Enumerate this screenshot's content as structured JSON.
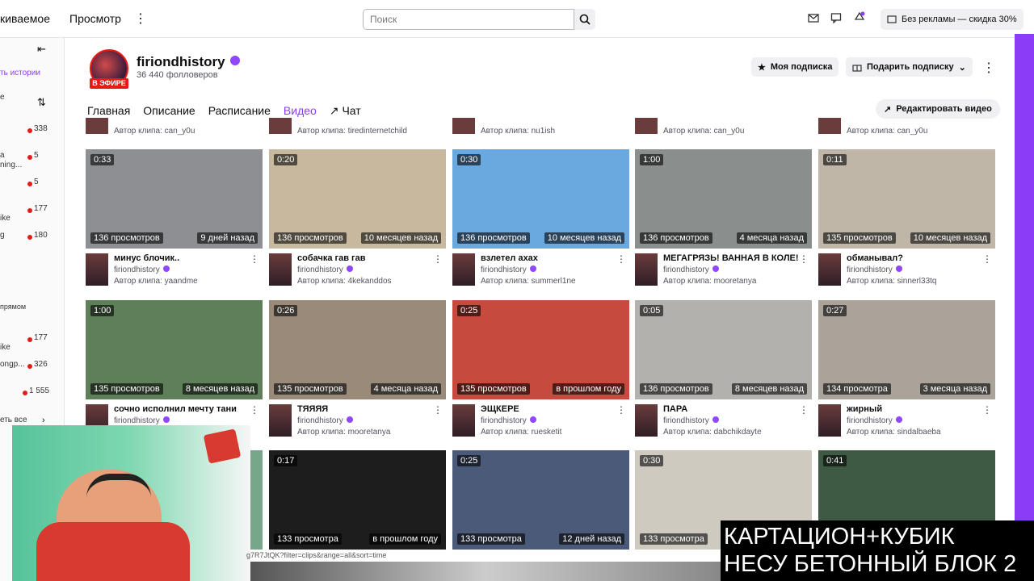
{
  "topbar": {
    "tab_following": "киваемое",
    "tab_browse": "Просмотр",
    "search_placeholder": "Поиск",
    "promo": "Без рекламы — скидка 30%"
  },
  "sidebar": {
    "collapse_label": "",
    "story_label": "ть истории",
    "items": [
      {
        "label": "е",
        "count": ""
      },
      {
        "label": "",
        "count": "338"
      },
      {
        "label": "а",
        "count": "5"
      },
      {
        "label": "ning...",
        "count": ""
      },
      {
        "label": "",
        "count": "5"
      },
      {
        "label": "",
        "count": "177"
      },
      {
        "label": "ike",
        "count": ""
      },
      {
        "label": "g",
        "count": "180"
      },
      {
        "label": "прямом",
        "count": ""
      },
      {
        "label": "",
        "count": "177"
      },
      {
        "label": "ike",
        "count": ""
      },
      {
        "label": "ongp...",
        "count": "326"
      },
      {
        "label": "",
        "count": "1 555"
      },
      {
        "label": "еть все",
        "count": ""
      }
    ]
  },
  "channel": {
    "name": "firiondhistory",
    "followers": "36 440 фолловеров",
    "live_badge": "В ЭФИРЕ",
    "subscribe_btn": "Моя подписка",
    "gift_btn": "Подарить подписку",
    "edit_btn": "Редактировать видео"
  },
  "tabs": [
    "Главная",
    "Описание",
    "Расписание",
    "Видео",
    "Чат"
  ],
  "prev_row": [
    {
      "author": "Автор клипа: can_y0u"
    },
    {
      "author": "Автор клипа: tiredinternetchild"
    },
    {
      "author": "Автор клипа: nu1ish"
    },
    {
      "author": "Автор клипа: can_y0u"
    },
    {
      "author": "Автор клипа: can_y0u"
    }
  ],
  "clips_row1": [
    {
      "dur": "0:33",
      "views": "136 просмотров",
      "ago": "9 дней назад",
      "title": "минус блочик..",
      "channel": "firiondhistory",
      "author": "Автор клипа: yaandme",
      "color": "#8d8f92"
    },
    {
      "dur": "0:20",
      "views": "136 просмотров",
      "ago": "10 месяцев назад",
      "title": "собачка гав гав",
      "channel": "firiondhistory",
      "author": "Автор клипа: 4kekanddos",
      "color": "#c7b89e"
    },
    {
      "dur": "0:30",
      "views": "136 просмотров",
      "ago": "10 месяцев назад",
      "title": "взлетел ахах",
      "channel": "firiondhistory",
      "author": "Автор клипа: summerl1ne",
      "color": "#6aa9e0"
    },
    {
      "dur": "1:00",
      "views": "136 просмотров",
      "ago": "4 месяца назад",
      "title": "МЕГАГРЯЗЬ! ВАННАЯ В КОЛЕ!",
      "channel": "firiondhistory",
      "author": "Автор клипа: mooretanya",
      "color": "#8a8e8c"
    },
    {
      "dur": "0:11",
      "views": "135 просмотров",
      "ago": "10 месяцев назад",
      "title": "обманывал?",
      "channel": "firiondhistory",
      "author": "Автор клипа: sinnerl33tq",
      "color": "#bfb6a8"
    }
  ],
  "clips_row2": [
    {
      "dur": "1:00",
      "views": "135 просмотров",
      "ago": "8 месяцев назад",
      "title": "сочно исполнил мечту тани",
      "channel": "firiondhistory",
      "author": "",
      "color": "#5f7f5a"
    },
    {
      "dur": "0:26",
      "views": "135 просмотров",
      "ago": "4 месяца назад",
      "title": "ТЯЯЯЯ",
      "channel": "firiondhistory",
      "author": "Автор клипа: mooretanya",
      "color": "#9a8a7a"
    },
    {
      "dur": "0:25",
      "views": "135 просмотров",
      "ago": "в прошлом году",
      "title": "ЭЩКЕРЕ",
      "channel": "firiondhistory",
      "author": "Автор клипа: ruesketit",
      "color": "#c64a3e"
    },
    {
      "dur": "0:05",
      "views": "136 просмотров",
      "ago": "8 месяцев назад",
      "title": "ПАРА",
      "channel": "firiondhistory",
      "author": "Автор клипа: dabchikdayte",
      "color": "#b3b1ad"
    },
    {
      "dur": "0:27",
      "views": "134 просмотра",
      "ago": "3 месяца назад",
      "title": "жирный",
      "channel": "firiondhistory",
      "author": "Автор клипа: sindalbaeba",
      "color": "#a9a39a"
    }
  ],
  "clips_row3": [
    {
      "dur": "",
      "views": "",
      "ago": "",
      "color": "#78a68a"
    },
    {
      "dur": "0:17",
      "views": "133 просмотра",
      "ago": "в прошлом году",
      "color": "#1d1d1d"
    },
    {
      "dur": "0:25",
      "views": "133 просмотра",
      "ago": "12 дней назад",
      "color": "#4a5a78"
    },
    {
      "dur": "0:30",
      "views": "133 просмотра",
      "ago": "",
      "color": "#cfcac0"
    },
    {
      "dur": "0:41",
      "views": "",
      "ago": "",
      "color": "#3f5a44"
    }
  ],
  "stream_overlay": {
    "line1": "КАРТАЦИОН+КУБИК",
    "line2": "НЕСУ БЕТОННЫЙ БЛОК 2"
  },
  "status_url": "g7R7JtQK?filter=clips&range=all&sort=time"
}
